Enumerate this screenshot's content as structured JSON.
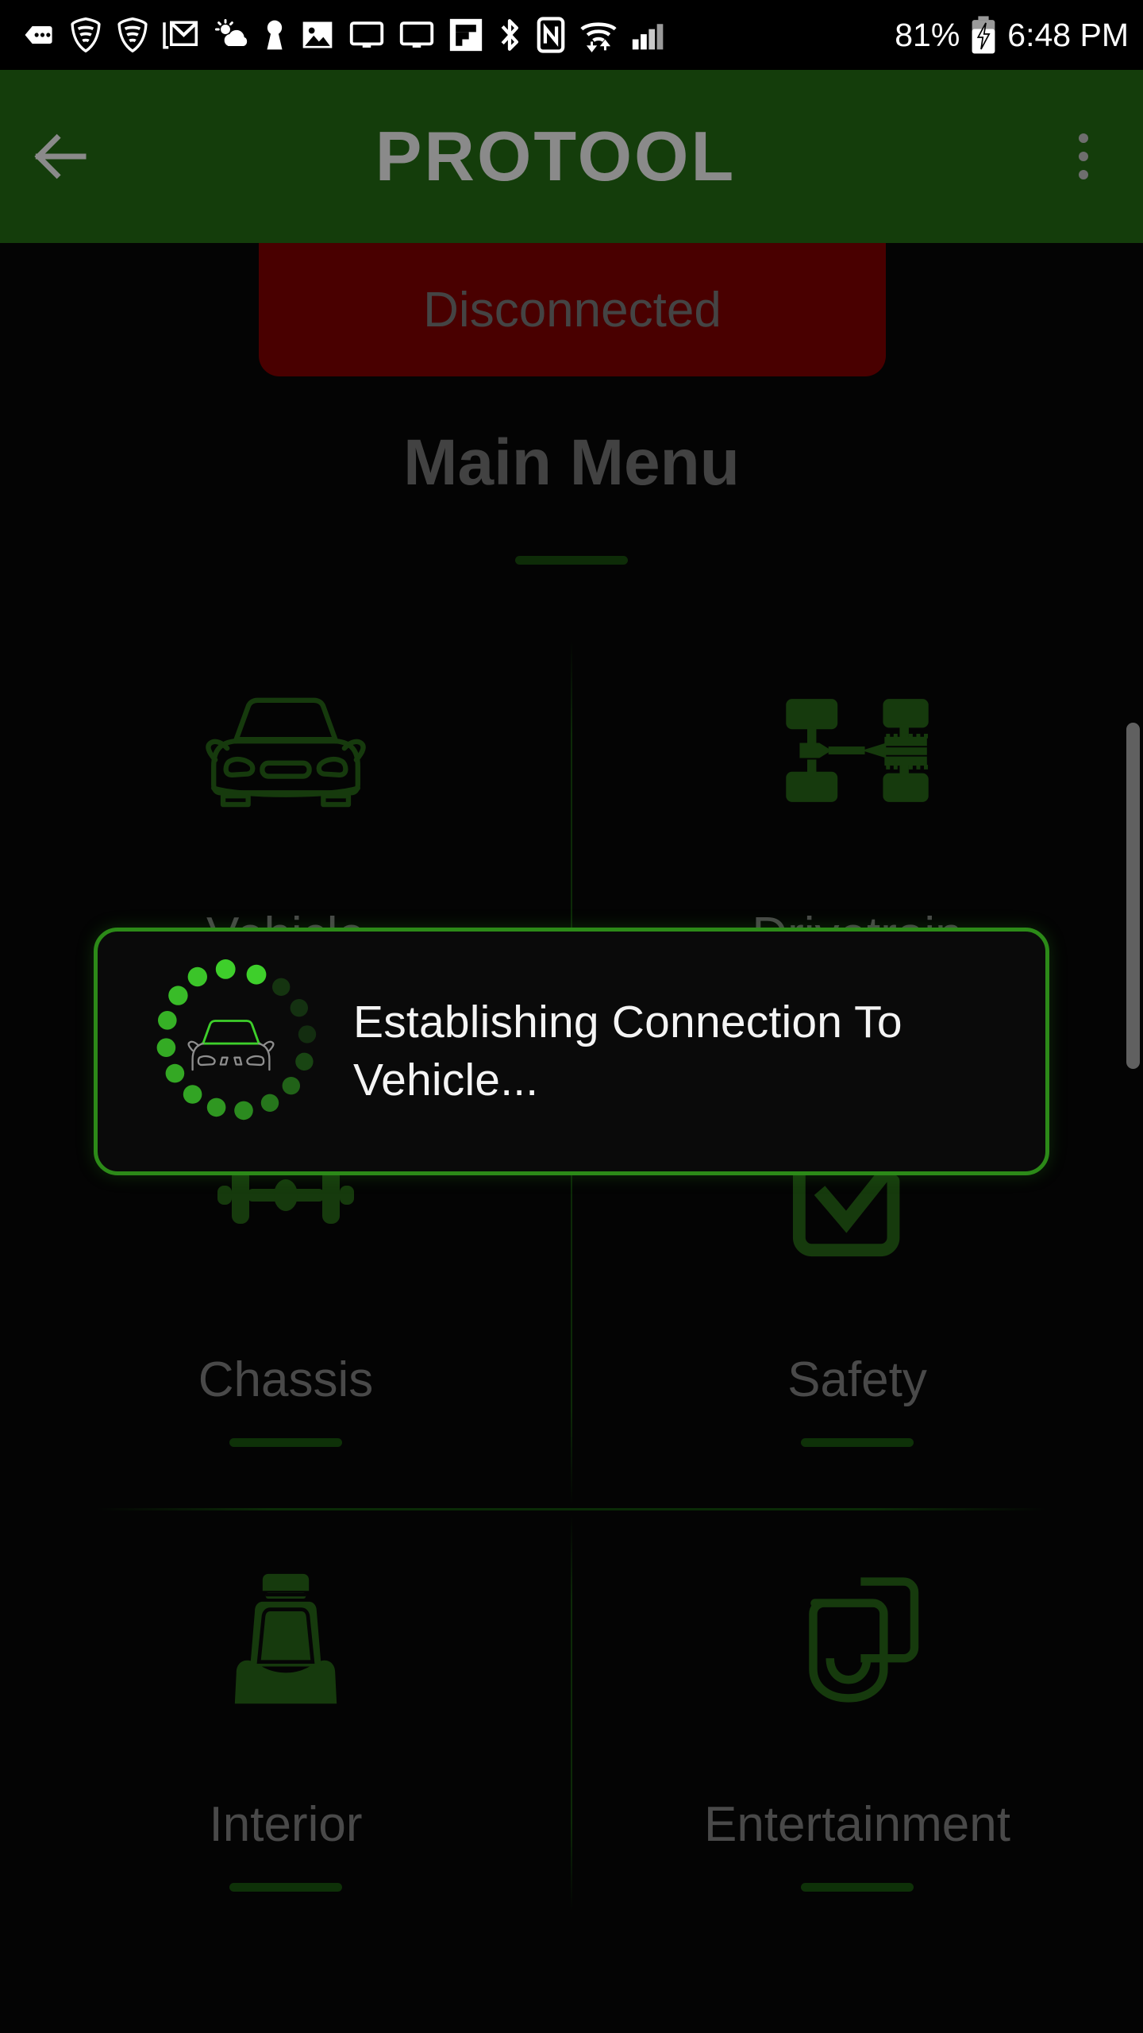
{
  "statusbar": {
    "left_icons": [
      {
        "name": "messages-icon",
        "label": "messages"
      },
      {
        "name": "wifi-shield-icon",
        "label": "secure-wifi"
      },
      {
        "name": "wifi-shield-icon-2",
        "label": "secure-wifi-2"
      },
      {
        "name": "gmail-icon",
        "label": "gmail"
      },
      {
        "name": "weather-icon",
        "label": "weather"
      },
      {
        "name": "keyhole-icon",
        "label": "vpn-key"
      },
      {
        "name": "photos-icon",
        "label": "photos"
      },
      {
        "name": "screen-cast-icon",
        "label": "screen-1"
      },
      {
        "name": "screen-cast-icon-2",
        "label": "screen-2"
      },
      {
        "name": "flipboard-icon",
        "label": "flipboard"
      },
      {
        "name": "bluetooth-icon",
        "label": "bluetooth"
      },
      {
        "name": "nfc-icon",
        "label": "nfc"
      },
      {
        "name": "wifi-data-icon",
        "label": "wifi-transfer"
      },
      {
        "name": "signal-bars-icon",
        "label": "cell-signal"
      }
    ],
    "battery_percent": "81%",
    "battery_state": "charging",
    "clock": "6:48 PM"
  },
  "appbar": {
    "title": "PROTOOL",
    "back_icon": "arrow-left-icon",
    "overflow_icon": "more-vertical-icon"
  },
  "connection": {
    "status_label": "Disconnected",
    "status_color": "#990000"
  },
  "main": {
    "heading": "Main Menu"
  },
  "menu": {
    "items": [
      {
        "label": "Vehicle",
        "icon": "car-front-icon"
      },
      {
        "label": "Drivetrain",
        "icon": "drivetrain-icon"
      },
      {
        "label": "Chassis",
        "icon": "chassis-axle-icon"
      },
      {
        "label": "Safety",
        "icon": "checkbox-check-icon"
      },
      {
        "label": "Interior",
        "icon": "car-seat-icon"
      },
      {
        "label": "Entertainment",
        "icon": "media-speakers-icon"
      }
    ]
  },
  "dialog": {
    "message": "Establishing Connection To Vehicle...",
    "spinner_icon": "dotted-ring-spinner",
    "center_icon": "car-outline-icon",
    "border_color": "#2c8a18"
  },
  "theme": {
    "accent_green": "#2c8a18",
    "appbar_green": "#143d0b",
    "background": "#090909",
    "muted_text": "#8a8a8a"
  }
}
